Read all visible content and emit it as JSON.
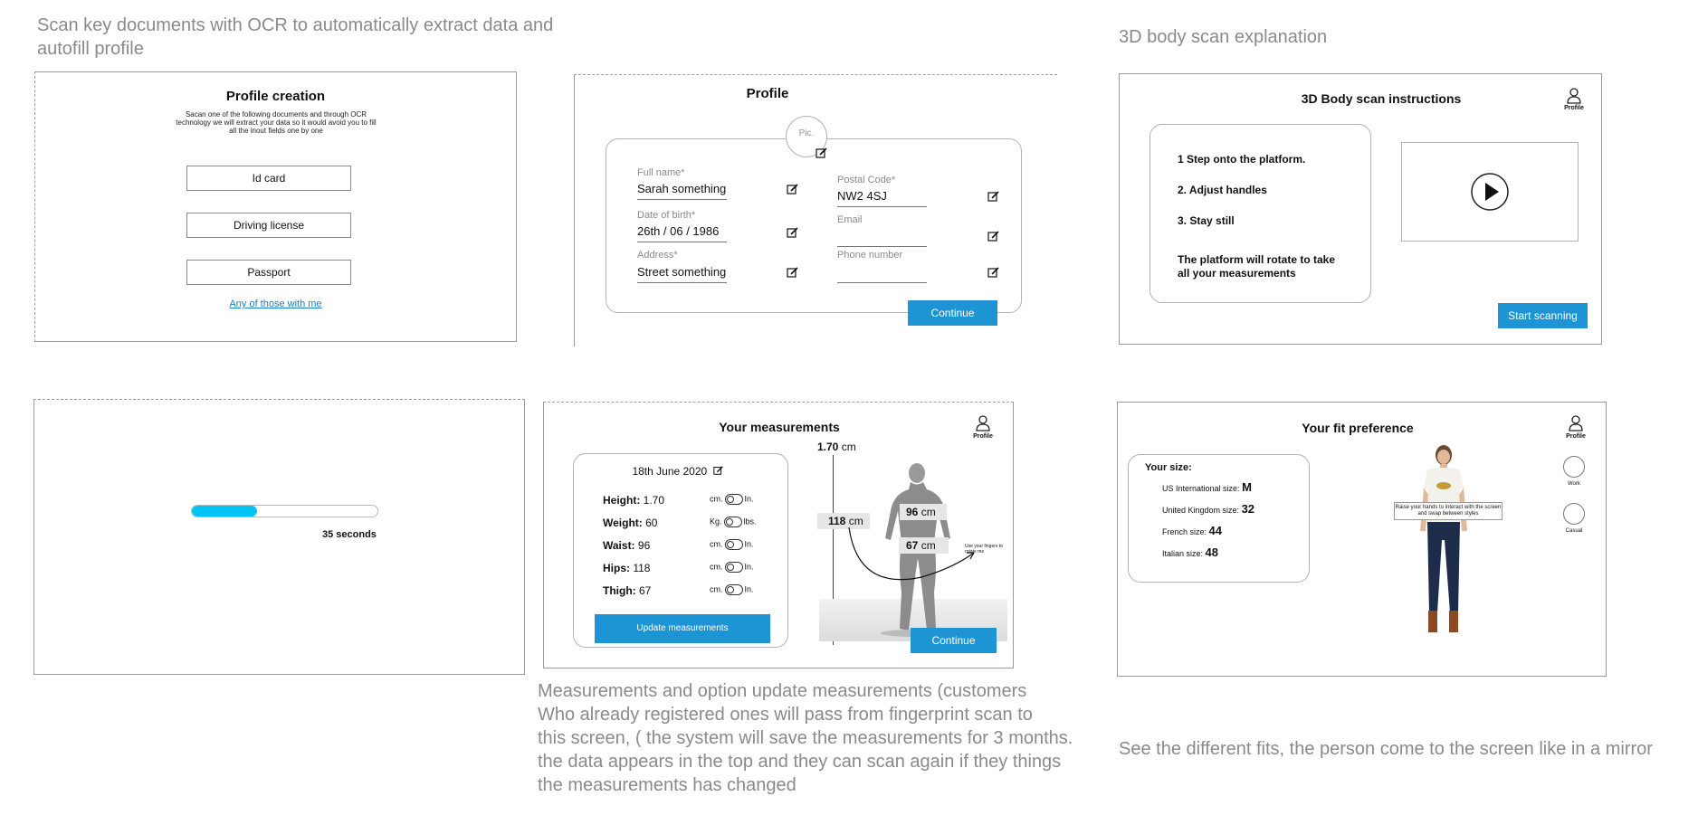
{
  "captions": {
    "ocr": "Scan key documents with OCR to automatically extract data and autofill profile",
    "body_scan": "3D body scan explanation",
    "measurements_lines": [
      "Measurements and option update measurements (customers",
      "Who already registered ones will pass from fingerprint scan to",
      "this screen, ( the system will save the measurements for 3 months.",
      "the data appears in the top and they can scan again if they things",
      "the measurements has changed"
    ],
    "fit": "See the different fits, the person come to the screen like in a mirror"
  },
  "profile_creation": {
    "title": "Profile creation",
    "description": "Sacan one of the following documents and through OCR technology we will extract your data so it would avoid you to fill all the inout fields one by one",
    "buttons": [
      "Id card",
      "Driving license",
      "Passport"
    ],
    "link": "Any of those with me"
  },
  "profile": {
    "title": "Profile",
    "pic_label": "Pic.",
    "fields": {
      "full_name": {
        "label": "Full name*",
        "value": "Sarah something"
      },
      "dob": {
        "label": "Date of birth*",
        "value": "26th / 06 / 1986"
      },
      "address": {
        "label": "Address*",
        "value": "Street something"
      },
      "postal": {
        "label": "Postal Code*",
        "value": "NW2 4SJ"
      },
      "email": {
        "label": "Email",
        "value": ""
      },
      "phone": {
        "label": "Phone number",
        "value": ""
      }
    },
    "continue": "Continue"
  },
  "body_scan": {
    "title": "3D Body scan instructions",
    "profile_label": "Profile",
    "steps": [
      "1 Step onto the platform.",
      "2. Adjust handles",
      "3. Stay still"
    ],
    "note": "The platform will rotate to take all your measurements",
    "start": "Start scanning"
  },
  "progress": {
    "fraction": 0.35,
    "label": "35 seconds"
  },
  "measurements": {
    "title": "Your measurements",
    "profile_label": "Profile",
    "date": "18th June 2020",
    "rows": [
      {
        "name": "Height:",
        "value": "1.70",
        "unit_a": "cm.",
        "unit_b": "In."
      },
      {
        "name": "Weight:",
        "value": "60",
        "unit_a": "Kg.",
        "unit_b": "lbs."
      },
      {
        "name": "Waist:",
        "value": "96",
        "unit_a": "cm.",
        "unit_b": "In."
      },
      {
        "name": "Hips:",
        "value": "118",
        "unit_a": "cm.",
        "unit_b": "In."
      },
      {
        "name": "Thigh:",
        "value": "67",
        "unit_a": "cm.",
        "unit_b": "In."
      }
    ],
    "update": "Update measurements",
    "height_label": "1.70",
    "height_unit": "cm",
    "hips_label": "118",
    "hips_unit": "cm",
    "waist_label": "96",
    "waist_unit": "cm",
    "thigh_label": "67",
    "thigh_unit": "cm",
    "rotate_hint": "Use your fingers to rotate me",
    "continue": "Continue"
  },
  "fit": {
    "title": "Your fit preference",
    "profile_label": "Profile",
    "size_heading": "Your size:",
    "sizes": [
      {
        "label": "US International size:",
        "value": "M"
      },
      {
        "label": "United Kingdom size:",
        "value": "32"
      },
      {
        "label": "French size:",
        "value": "44"
      },
      {
        "label": "Italian size:",
        "value": "48"
      }
    ],
    "tooltip": "Raise your hands to interact with the screen and swap between styles",
    "options": [
      "Work",
      "Casual"
    ]
  },
  "colors": {
    "accent": "#1d95d4",
    "progress": "#00c3f5",
    "caption": "#8a8a8a"
  }
}
